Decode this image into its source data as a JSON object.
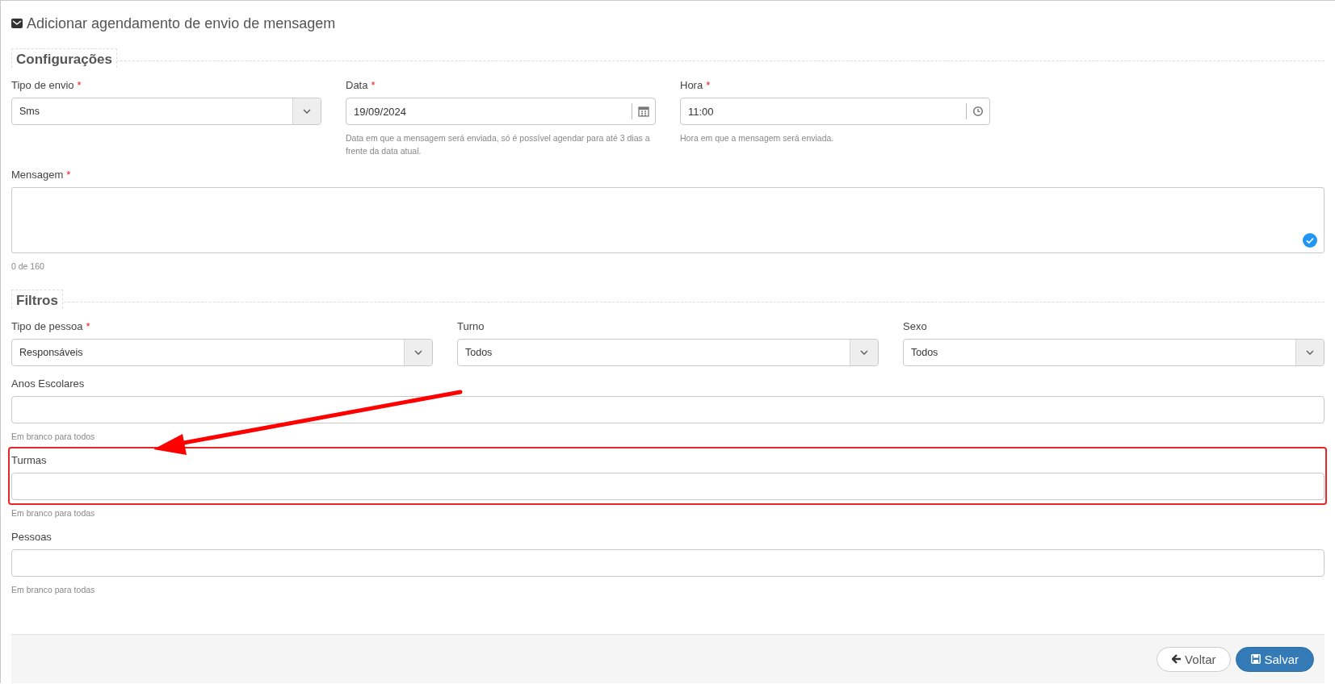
{
  "title": "Adicionar agendamento de envio de mensagem",
  "sections": [
    {
      "legend": "Configurações",
      "rows": [
        {
          "kind": "quarters",
          "fields": [
            {
              "kind": "select",
              "label": "Tipo de envio",
              "required_mark": "*",
              "value": "Sms"
            },
            {
              "kind": "input",
              "label": "Data",
              "required_mark": "*",
              "value": "19/09/2024",
              "addon": {
                "kind": "calendar"
              },
              "help": "Data em que a mensagem será enviada, só é possível agendar para até 3 dias a frente da data atual."
            },
            {
              "kind": "input",
              "label": "Hora",
              "required_mark": "*",
              "value": "11:00",
              "addon": {
                "kind": "clock"
              },
              "help": "Hora em que a mensagem será enviada."
            }
          ]
        },
        {
          "kind": "full",
          "fields": [
            {
              "kind": "textarea",
              "label": "Mensagem",
              "required_mark": "*",
              "valid": true,
              "help": "0 de 160"
            }
          ]
        }
      ]
    },
    {
      "legend": "Filtros",
      "rows": [
        {
          "kind": "thirds",
          "fields": [
            {
              "kind": "select",
              "label": "Tipo de pessoa",
              "required_mark": "*",
              "value": "Responsáveis"
            },
            {
              "kind": "select",
              "label": "Turno",
              "value": "Todos"
            },
            {
              "kind": "select",
              "label": "Sexo",
              "value": "Todos"
            }
          ]
        },
        {
          "kind": "full",
          "fields": [
            {
              "kind": "input",
              "label": "Anos Escolares",
              "help": "Em branco para todos"
            }
          ]
        },
        {
          "kind": "full",
          "fields": [
            {
              "kind": "input",
              "label": "Turmas",
              "help": "Em branco para todas",
              "highlighted": true
            }
          ]
        },
        {
          "kind": "full",
          "fields": [
            {
              "kind": "input",
              "label": "Pessoas",
              "help": "Em branco para todas"
            }
          ]
        }
      ]
    }
  ],
  "buttons": [
    {
      "kind": "back",
      "label": "Voltar"
    },
    {
      "kind": "save",
      "label": "Salvar"
    }
  ]
}
